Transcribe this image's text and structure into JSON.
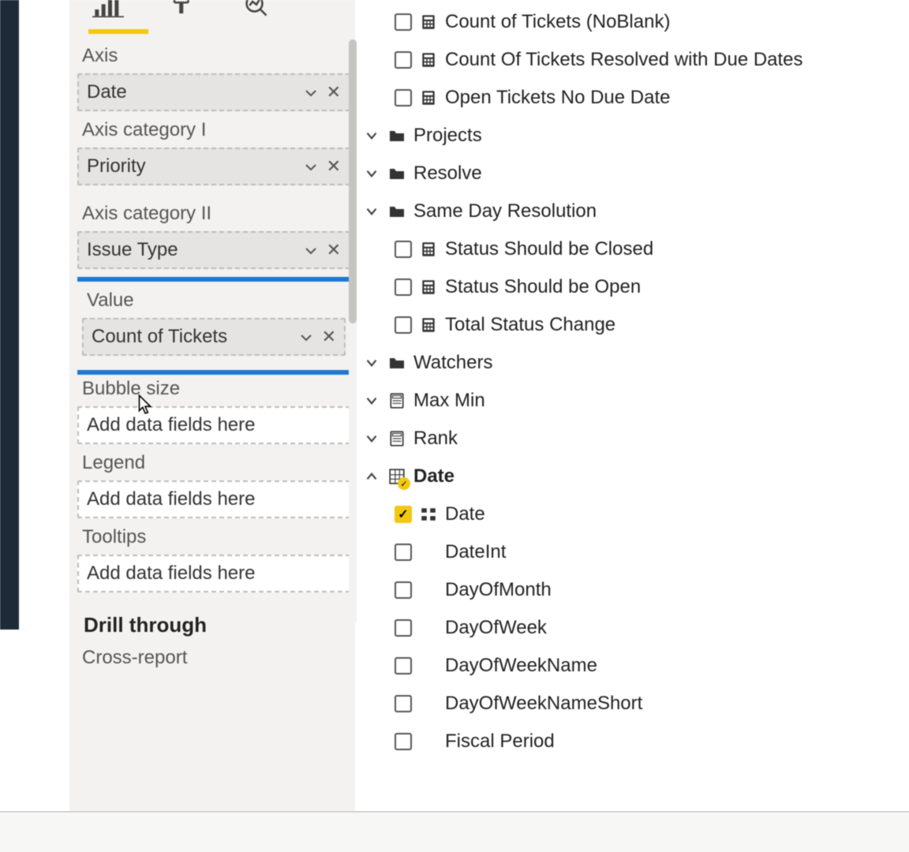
{
  "wells": {
    "axis": {
      "label": "Axis",
      "value": "Date"
    },
    "axis_cat1": {
      "label": "Axis category I",
      "value": "Priority"
    },
    "axis_cat2": {
      "label": "Axis category II",
      "value": "Issue Type"
    },
    "value": {
      "label": "Value",
      "value": "Count of Tickets"
    },
    "bubble": {
      "label": "Bubble size",
      "placeholder": "Add data fields here"
    },
    "legend": {
      "label": "Legend",
      "placeholder": "Add data fields here"
    },
    "tooltips": {
      "label": "Tooltips",
      "placeholder": "Add data fields here"
    },
    "drillthrough": "Drill through",
    "crossreport": "Cross-report"
  },
  "fields": {
    "measures_top": [
      "Count of Tickets (NoBlank)",
      "Count Of Tickets Resolved with Due Dates",
      "Open Tickets No Due Date"
    ],
    "folders": [
      {
        "name": "Projects"
      },
      {
        "name": "Resolve"
      },
      {
        "name": "Same Day Resolution",
        "children": [
          "Status Should be Closed",
          "Status Should be Open",
          "Total Status Change"
        ]
      },
      {
        "name": "Watchers"
      }
    ],
    "outline_measures": [
      "Max Min",
      "Rank"
    ],
    "date_table": {
      "name": "Date",
      "fields": [
        {
          "name": "Date",
          "checked": true,
          "hierarchy": true
        },
        {
          "name": "DateInt"
        },
        {
          "name": "DayOfMonth"
        },
        {
          "name": "DayOfWeek"
        },
        {
          "name": "DayOfWeekName"
        },
        {
          "name": "DayOfWeekNameShort"
        },
        {
          "name": "Fiscal Period"
        }
      ]
    }
  }
}
